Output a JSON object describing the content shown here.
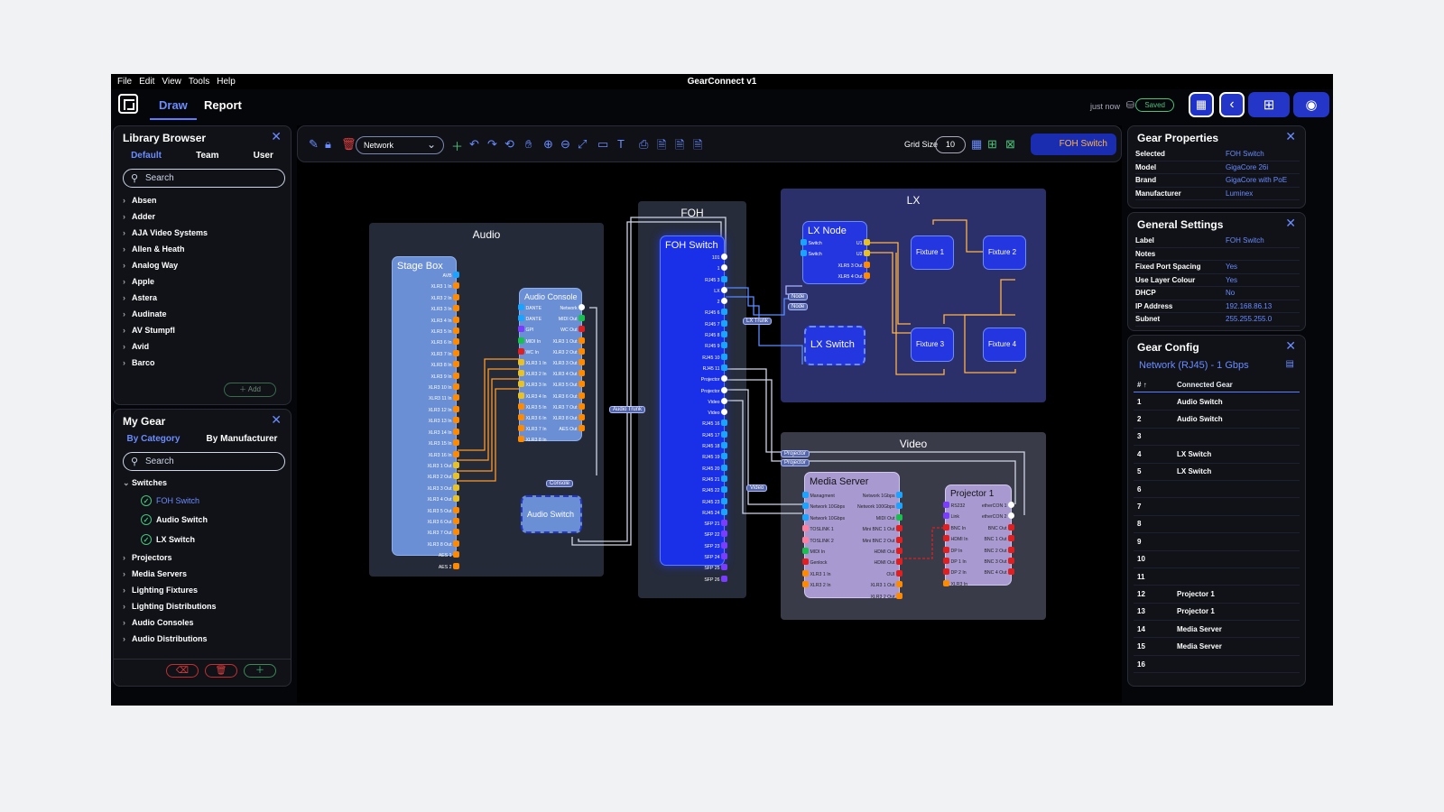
{
  "window_title": "GearConnect  v1",
  "menu": [
    "File",
    "Edit",
    "View",
    "Tools",
    "Help"
  ],
  "tabs": {
    "draw": "Draw",
    "report": "Report"
  },
  "status": {
    "time": "just now",
    "saved": "Saved"
  },
  "library": {
    "title": "Library Browser",
    "tabs": [
      "Default",
      "Team",
      "User"
    ],
    "search_placeholder": "Search",
    "items": [
      "Absen",
      "Adder",
      "AJA Video Systems",
      "Allen & Heath",
      "Analog Way",
      "Apple",
      "Astera",
      "Audinate",
      "AV Stumpfl",
      "Avid",
      "Barco"
    ],
    "add": "Add"
  },
  "mygear": {
    "title": "My Gear",
    "tabs": [
      "By Category",
      "By Manufacturer"
    ],
    "search_placeholder": "Search",
    "switches": "Switches",
    "switch_items": [
      "FOH Switch",
      "Audio Switch",
      "LX Switch"
    ],
    "categories": [
      "Projectors",
      "Media Servers",
      "Lighting Fixtures",
      "Lighting Distributions",
      "Audio Consoles",
      "Audio Distributions"
    ]
  },
  "toolbar": {
    "layer": "Network",
    "grid_label": "Grid Size",
    "grid_value": "10",
    "selected": "FOH Switch"
  },
  "zones": {
    "audio": "Audio",
    "foh": "FOH",
    "lx": "LX",
    "video": "Video"
  },
  "devices": {
    "stagebox": {
      "title": "Stage Box",
      "ports": [
        "AVB",
        "XLR3 1 In",
        "XLR3 2 In",
        "XLR3 3 In",
        "XLR3 4 In",
        "XLR3 5 In",
        "XLR3 6 In",
        "XLR3 7 In",
        "XLR3 8 In",
        "XLR3 9 In",
        "XLR3 10 In",
        "XLR3 11 In",
        "XLR3 12 In",
        "XLR3 13 In",
        "XLR3 14 In",
        "XLR3 15 In",
        "XLR3 16 In",
        "XLR3 1 Out",
        "XLR3 2 Out",
        "XLR3 3 Out",
        "XLR3 4 Out",
        "XLR3 5 Out",
        "XLR3 6 Out",
        "XLR3 7 Out",
        "XLR3 8 Out",
        "AES 1",
        "AES 2"
      ]
    },
    "console": {
      "title": "Audio Console",
      "left": [
        "DANTE",
        "DANTE",
        "GPI",
        "MIDI In",
        "WC In",
        "XLR3 1 In",
        "XLR3 2 In",
        "XLR3 3 In",
        "XLR3 4 In",
        "XLR3 5 In",
        "XLR3 6 In",
        "XLR3 7 In",
        "XLR3 8 In"
      ],
      "right": [
        "Network",
        "MIDI Out",
        "WC Out",
        "XLR3 1 Out",
        "XLR3 2 Out",
        "XLR3 3 Out",
        "XLR3 4 Out",
        "XLR3 5 Out",
        "XLR3 6 Out",
        "XLR3 7 Out",
        "XLR3 8 Out",
        "AES Out"
      ]
    },
    "audioswitch": {
      "title": "Audio Switch"
    },
    "fohswitch": {
      "title": "FOH Switch",
      "ports": [
        "101",
        "1",
        "RJ45 3",
        "LX",
        "2",
        "RJ45 6",
        "RJ45 7",
        "RJ45 8",
        "RJ45 9",
        "RJ45 10",
        "RJ45 11",
        "Projector",
        "Projector",
        "Video",
        "Video",
        "RJ45 16",
        "RJ45 17",
        "RJ45 18",
        "RJ45 19",
        "RJ45 20",
        "RJ45 21",
        "RJ45 22",
        "RJ45 23",
        "RJ45 24",
        "SFP 21",
        "SFP 22",
        "SFP 23",
        "SFP 24",
        "SFP 25",
        "SFP 26"
      ]
    },
    "lxnode": {
      "title": "LX Node",
      "left": [
        "Switch",
        "Switch"
      ],
      "right": [
        "U1",
        "U2",
        "XLR5 3 Out",
        "XLR5 4 Out"
      ]
    },
    "lxswitch": {
      "title": "LX Switch"
    },
    "fixtures": [
      "Fixture 1",
      "Fixture 2",
      "Fixture 3",
      "Fixture 4"
    ],
    "mediaserver": {
      "title": "Media Server",
      "left": [
        "Managment",
        "Network 10Gbps",
        "Network 10Gbps",
        "TOSLINK 1",
        "TOSLINK 2",
        "MIDI In",
        "Genlock",
        "XLR3 1 In",
        "XLR3 2 In"
      ],
      "right": [
        "Network 1Gbps",
        "Network 100Gbps",
        "MIDI Out",
        "Mini BNC 1 Out",
        "Mini BNC 2 Out",
        "HDMI Out",
        "HDMI Out",
        "OUI",
        "XLR3 1 Out",
        "XLR3 2 Out"
      ]
    },
    "projector": {
      "title": "Projector 1",
      "left": [
        "RS232",
        "Link",
        "BNC In",
        "HDMI In",
        "DP In",
        "DP 1 In",
        "DP 2 In",
        "XLR3 In"
      ],
      "right": [
        "etherCON 1",
        "etherCON 2",
        "BNC Out",
        "BNC 1 Out",
        "BNC 2 Out",
        "BNC 3 Out",
        "BNC 4 Out"
      ]
    }
  },
  "tags": {
    "audio_trunk": "Audio Trunk",
    "console": "Console",
    "lx_trunk": "LX Trunk",
    "node1": "Node",
    "node2": "Node",
    "projector1": "Projector",
    "projector2": "Projector",
    "video": "Video"
  },
  "gear_props": {
    "title": "Gear Properties",
    "rows": [
      [
        "Selected",
        "FOH Switch"
      ],
      [
        "Model",
        "GigaCore 26i"
      ],
      [
        "Brand",
        "GigaCore with PoE"
      ],
      [
        "Manufacturer",
        "Luminex"
      ]
    ]
  },
  "general": {
    "title": "General Settings",
    "rows": [
      [
        "Label",
        "FOH Switch"
      ],
      [
        "Notes",
        ""
      ],
      [
        "Fixed Port Spacing",
        "Yes"
      ],
      [
        "Use Layer Colour",
        "Yes"
      ],
      [
        "DHCP",
        "No"
      ],
      [
        "IP Address",
        "192.168.86.13"
      ],
      [
        "Subnet",
        "255.255.255.0"
      ]
    ]
  },
  "config": {
    "title": "Gear Config",
    "subtitle": "Network (RJ45) - 1 Gbps",
    "col_num": "#",
    "col_gear": "Connected Gear",
    "rows": [
      [
        "1",
        "Audio Switch"
      ],
      [
        "2",
        "Audio Switch"
      ],
      [
        "3",
        ""
      ],
      [
        "4",
        "LX Switch"
      ],
      [
        "5",
        "LX Switch"
      ],
      [
        "6",
        ""
      ],
      [
        "7",
        ""
      ],
      [
        "8",
        ""
      ],
      [
        "9",
        ""
      ],
      [
        "10",
        ""
      ],
      [
        "11",
        ""
      ],
      [
        "12",
        "Projector 1"
      ],
      [
        "13",
        "Projector 1"
      ],
      [
        "14",
        "Media Server"
      ],
      [
        "15",
        "Media Server"
      ],
      [
        "16",
        ""
      ]
    ]
  },
  "colors": {
    "accent": "#6b8cff",
    "brand": "#2336c8",
    "saved": "#49c27a",
    "port_orange": "#ff8a00",
    "port_blue": "#1aa3ff"
  }
}
